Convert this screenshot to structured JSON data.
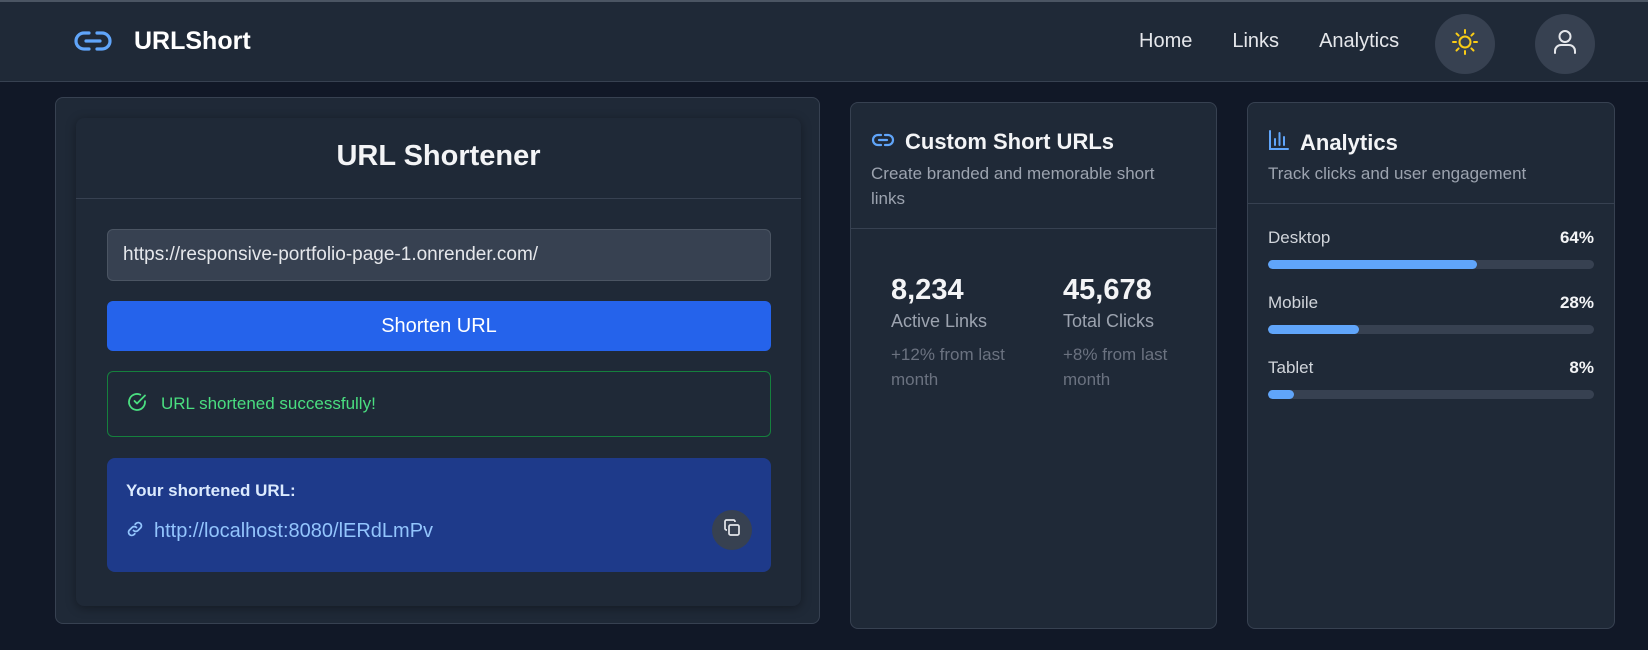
{
  "nav": {
    "brand": "URLShort",
    "links": [
      "Home",
      "Links",
      "Analytics"
    ]
  },
  "shortener": {
    "title": "URL Shortener",
    "input_value": "https://responsive-portfolio-page-1.onrender.com/",
    "button_label": "Shorten URL",
    "success_message": "URL shortened successfully!",
    "result_label": "Your shortened URL:",
    "short_url": "http://localhost:8080/lERdLmPv"
  },
  "custom_urls": {
    "title": "Custom Short URLs",
    "description": "Create branded and memorable short links",
    "stats": [
      {
        "value": "8,234",
        "label": "Active Links",
        "change": "+12% from last month"
      },
      {
        "value": "45,678",
        "label": "Total Clicks",
        "change": "+8% from last month"
      }
    ]
  },
  "analytics": {
    "title": "Analytics",
    "description": "Track clicks and user engagement",
    "devices": [
      {
        "name": "Desktop",
        "percent_label": "64%",
        "percent": 64
      },
      {
        "name": "Mobile",
        "percent_label": "28%",
        "percent": 28
      },
      {
        "name": "Tablet",
        "percent_label": "8%",
        "percent": 8
      }
    ]
  },
  "colors": {
    "background": "#111827",
    "surface": "#1f2937",
    "primary": "#2563eb",
    "accent_blue": "#60a5fa",
    "success_green": "#4ade80",
    "result_bg": "#1e3a8a",
    "sun_yellow": "#facc15"
  },
  "icons": {
    "brand": "link-icon",
    "theme": "sun-icon",
    "user": "user-icon",
    "success": "check-circle-icon",
    "result_link": "link-icon",
    "copy": "copy-icon",
    "custom_urls": "link-icon",
    "analytics": "bar-chart-icon"
  }
}
